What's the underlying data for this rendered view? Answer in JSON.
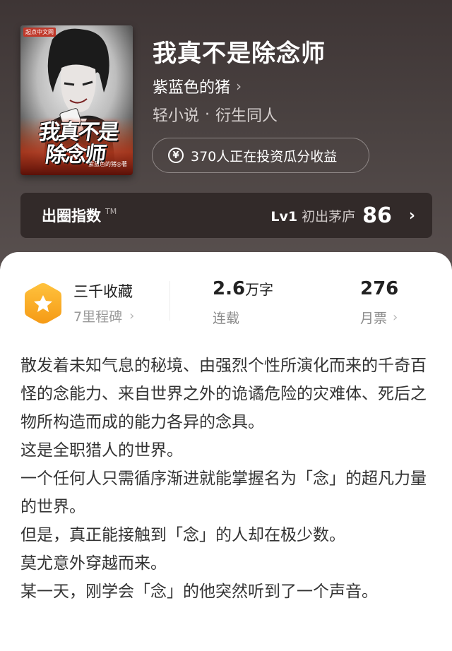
{
  "book": {
    "title": "我真不是除念师",
    "author": "紫蓝色的猪",
    "category": "轻小说",
    "subcategory": "衍生同人",
    "invest_text": "370人正在投资瓜分收益"
  },
  "cover": {
    "publisher": "起点中文网",
    "title_line1": "我真不是",
    "title_line2": "除念师",
    "author_mark": "紫蓝色的猪◎著"
  },
  "popularity": {
    "label": "出圈指数",
    "tm": "TM",
    "level_code": "Lv1",
    "level_name": "初出茅庐",
    "score": "86"
  },
  "stats": {
    "collection_title": "三千收藏",
    "milestone": "7里程碑",
    "word_count": "2.6",
    "word_unit": "万字",
    "status": "连载",
    "monthly_tickets": "276",
    "monthly_label": "月票"
  },
  "synopsis": [
    "散发着未知气息的秘境、由强烈个性所演化而来的千奇百怪的念能力、来自世界之外的诡谲危险的灾难体、死后之物所构造而成的能力各异的念具。",
    "这是全职猎人的世界。",
    "一个任何人只需循序渐进就能掌握名为「念」的超凡力量的世界。",
    "但是，真正能接触到「念」的人却在极少数。",
    "莫尤意外穿越而来。",
    "某一天，刚学会「念」的他突然听到了一个声音。"
  ],
  "colors": {
    "hero_bg": "#4a4241",
    "popularity_bg": "#322a29",
    "badge_orange": "#f5a623",
    "text_dark": "#333333"
  },
  "icons": {
    "author_chevron": "chevron-right-icon",
    "yen": "yen-coin-icon",
    "badge": "star-hexagon-badge-icon"
  }
}
